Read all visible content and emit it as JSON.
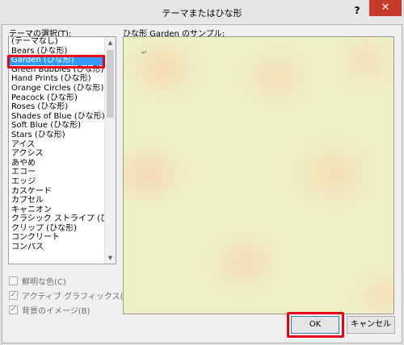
{
  "window": {
    "title": "テーマまたはひな形",
    "help_glyph": "?",
    "close_glyph": "✕"
  },
  "theme_list": {
    "label": "テーマの選択(T):",
    "selected_index": 2,
    "items": [
      "(テーマなし)",
      "Bears (ひな形)",
      "Garden (ひな形)",
      "Green Bubbles (ひな形)",
      "Hand Prints (ひな形)",
      "Orange Circles (ひな形)",
      "Peacock (ひな形)",
      "Roses (ひな形)",
      "Shades of Blue (ひな形)",
      "Soft Blue (ひな形)",
      "Stars (ひな形)",
      "アイス",
      "アクシス",
      "あやめ",
      "エコー",
      "エッジ",
      "カスケード",
      "カプセル",
      "キャニオン",
      "クラシック ストライプ (ひな形)",
      "クリップ (ひな形)",
      "コンクリート",
      "コンパス"
    ],
    "scroll_up_glyph": "▲",
    "scroll_down_glyph": "▼"
  },
  "options": {
    "vivid_colors": {
      "label": "鮮明な色(C)",
      "checked": false,
      "enabled": false
    },
    "active_graphics": {
      "label": "アクティブ グラフィックス(G)",
      "checked": true,
      "enabled": false
    },
    "background_image": {
      "label": "背景のイメージ(B)",
      "checked": true,
      "enabled": false
    },
    "check_glyph": "✓"
  },
  "sample": {
    "label": "ひな形 Garden のサンプル:",
    "paragraph_mark": "↵"
  },
  "buttons": {
    "ok_label": "OK",
    "cancel_label": "キャンセル"
  },
  "colors": {
    "selection": "#3399ff",
    "highlight_annotation": "#e8001c",
    "close_button": "#c7392b",
    "sample_background": "#eef0c4"
  }
}
